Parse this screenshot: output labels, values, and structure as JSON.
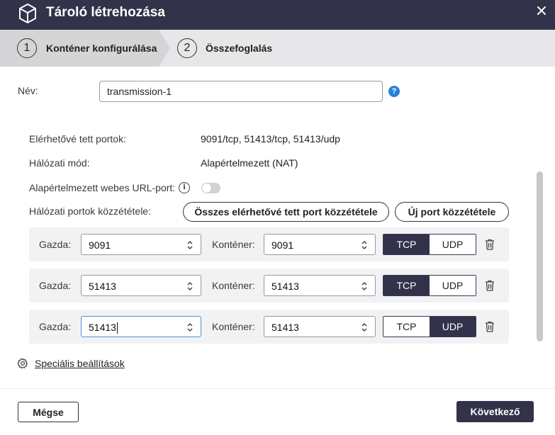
{
  "window": {
    "title": "Tároló létrehozása",
    "title_icon": "cube-icon",
    "close_icon": "close-icon",
    "header_color": "#32324a"
  },
  "steps": [
    {
      "number": "1",
      "label": "Konténer konfigurálása",
      "active": true
    },
    {
      "number": "2",
      "label": "Összefoglalás",
      "active": false
    }
  ],
  "form": {
    "name_label": "Név:",
    "name_value": "transmission-1",
    "help_icon": "?",
    "exposed_ports_label": "Elérhetővé tett portok:",
    "exposed_ports_value": "9091/tcp, 51413/tcp, 51413/udp",
    "network_mode_label": "Hálózati mód:",
    "network_mode_value": "Alapértelmezett (NAT)",
    "web_url_port_label": "Alapértelmezett webes URL-port:",
    "info_icon": "i",
    "web_url_port_enabled": false,
    "publish_ports_label": "Hálózati portok közzététele:",
    "publish_all_button": "Összes elérhetővé tett port közzététele",
    "new_port_button": "Új port közzététele"
  },
  "port_labels": {
    "host": "Gazda:",
    "container": "Konténer:"
  },
  "port_mappings": [
    {
      "host": "9091",
      "container": "9091",
      "tcp_label": "TCP",
      "udp_label": "UDP",
      "protocol": "TCP",
      "focused": false
    },
    {
      "host": "51413",
      "container": "51413",
      "tcp_label": "TCP",
      "udp_label": "UDP",
      "protocol": "TCP",
      "focused": false
    },
    {
      "host": "51413",
      "container": "51413",
      "tcp_label": "TCP",
      "udp_label": "UDP",
      "protocol": "UDP",
      "focused": true
    }
  ],
  "advanced": {
    "label": "Speciális beállítások",
    "icon": "gear-icon"
  },
  "footer": {
    "cancel_label": "Mégse",
    "next_label": "Következő",
    "primary_color": "#32324a"
  }
}
